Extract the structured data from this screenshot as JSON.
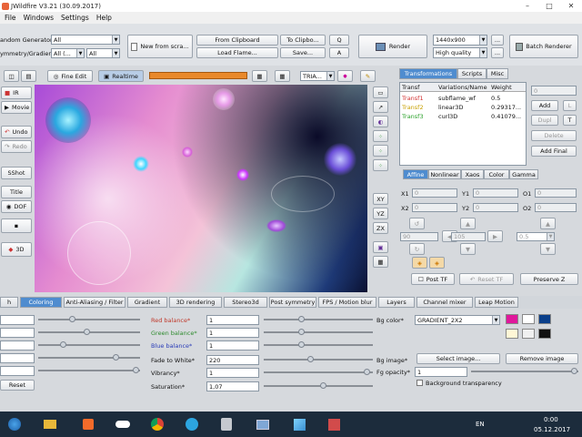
{
  "window": {
    "title": "JWildfire V3.21 (30.09.2017)",
    "minimize": "–",
    "maximize": "□",
    "close": "✕"
  },
  "menu": [
    "File",
    "Windows",
    "Settings",
    "Help"
  ],
  "toolbar": {
    "random_generator_label": "andom Generator",
    "random_generator_value": "All",
    "symmetry_label": "ymmetry/Gradient",
    "symmetry_value1": "All (...",
    "symmetry_value2": "All",
    "new_from_scratch": "New from scra...",
    "from_clipboard": "From Clipboard",
    "to_clipboard": "To Clipbo...",
    "load_flame": "Load Flame...",
    "save": "Save...",
    "q_label": "Q",
    "a_label": "A",
    "render": "Render",
    "resolution": "1440x900",
    "quality": "High quality",
    "more": "...",
    "batch_renderer": "Batch Renderer"
  },
  "edit_bar": {
    "fine_edit": "Fine Edit",
    "realtime": "Realtime",
    "tria": "TRIA..."
  },
  "left_buttons": [
    "IR",
    "Movie",
    "Undo",
    "Redo",
    "SShot",
    "Title",
    "DOF",
    "3D"
  ],
  "side_buttons": [
    "XY",
    "YZ",
    "ZX"
  ],
  "right_panel": {
    "tabs": [
      "Transformations",
      "Scripts",
      "Misc"
    ],
    "table_headers": [
      "Transf",
      "Variations/Name",
      "Weight"
    ],
    "rows": [
      {
        "transf": "Transf1",
        "name": "subflame_wf",
        "weight": "0.5",
        "color": "#d23030"
      },
      {
        "transf": "Transf2",
        "name": "linear3D",
        "weight": "0.29317...",
        "color": "#c8a000"
      },
      {
        "transf": "Transf3",
        "name": "curl3D",
        "weight": "0.41079...",
        "color": "#2aa12a"
      }
    ],
    "count_field": "0",
    "add": "Add",
    "l": "L",
    "dupl": "Dupl",
    "t": "T",
    "delete": "Delete",
    "add_final": "Add Final",
    "subtabs": [
      "Affine",
      "Nonlinear",
      "Xaos",
      "Color",
      "Gamma"
    ],
    "affine_labels": [
      "X1",
      "Y1",
      "O1",
      "X2",
      "Y2",
      "O2"
    ],
    "affine_values": [
      "0",
      "0",
      "0",
      "0",
      "0",
      "0"
    ],
    "rotate_fields": [
      "90",
      "105",
      "0.5"
    ],
    "post_tf": "Post TF",
    "reset_tf": "Reset TF",
    "preserve_z": "Preserve Z"
  },
  "bottom_tabs": [
    "h",
    "Coloring",
    "Anti-Aliasing / Filter",
    "Gradient",
    "3D rendering",
    "Stereo3d",
    "Post symmetry",
    "FPS / Motion blur",
    "Layers",
    "Channel mixer",
    "Leap Motion"
  ],
  "coloring": {
    "red_balance": {
      "label": "Red balance*",
      "value": "1"
    },
    "green_balance": {
      "label": "Green balance*",
      "value": "1"
    },
    "blue_balance": {
      "label": "Blue balance*",
      "value": "1"
    },
    "fade_to_white": {
      "label": "Fade to White*",
      "value": "220"
    },
    "vibrancy": {
      "label": "Vibrancy*",
      "value": "1"
    },
    "saturation": {
      "label": "Saturation*",
      "value": "1,07"
    },
    "bg_color": "Bg color*",
    "gradient_value": "GRADIENT_2X2",
    "bg_image": "Bg image*",
    "select_image": "Select image...",
    "remove_image": "Remove image",
    "fg_opacity": "Fg opacity*",
    "fg_opacity_value": "1",
    "background_transparency": "Background transparency",
    "reset": "Reset",
    "swatches": [
      "#e0189c",
      "#ffffff",
      "#0a3f8a",
      "#fff7d6",
      "#f0f0f0",
      "#111111"
    ]
  },
  "taskbar": {
    "lang": "EN",
    "time": "0:00",
    "date": "05.12.2017",
    "start_icon": "windows-logo-icon"
  }
}
